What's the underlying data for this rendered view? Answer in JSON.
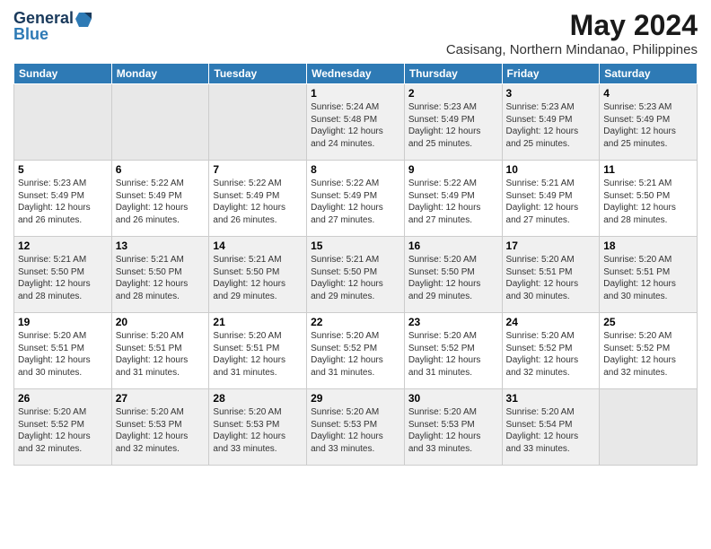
{
  "logo": {
    "line1": "General",
    "line2": "Blue"
  },
  "title": "May 2024",
  "subtitle": "Casisang, Northern Mindanao, Philippines",
  "weekdays": [
    "Sunday",
    "Monday",
    "Tuesday",
    "Wednesday",
    "Thursday",
    "Friday",
    "Saturday"
  ],
  "weeks": [
    [
      {
        "day": "",
        "info": ""
      },
      {
        "day": "",
        "info": ""
      },
      {
        "day": "",
        "info": ""
      },
      {
        "day": "1",
        "info": "Sunrise: 5:24 AM\nSunset: 5:48 PM\nDaylight: 12 hours\nand 24 minutes."
      },
      {
        "day": "2",
        "info": "Sunrise: 5:23 AM\nSunset: 5:49 PM\nDaylight: 12 hours\nand 25 minutes."
      },
      {
        "day": "3",
        "info": "Sunrise: 5:23 AM\nSunset: 5:49 PM\nDaylight: 12 hours\nand 25 minutes."
      },
      {
        "day": "4",
        "info": "Sunrise: 5:23 AM\nSunset: 5:49 PM\nDaylight: 12 hours\nand 25 minutes."
      }
    ],
    [
      {
        "day": "5",
        "info": "Sunrise: 5:23 AM\nSunset: 5:49 PM\nDaylight: 12 hours\nand 26 minutes."
      },
      {
        "day": "6",
        "info": "Sunrise: 5:22 AM\nSunset: 5:49 PM\nDaylight: 12 hours\nand 26 minutes."
      },
      {
        "day": "7",
        "info": "Sunrise: 5:22 AM\nSunset: 5:49 PM\nDaylight: 12 hours\nand 26 minutes."
      },
      {
        "day": "8",
        "info": "Sunrise: 5:22 AM\nSunset: 5:49 PM\nDaylight: 12 hours\nand 27 minutes."
      },
      {
        "day": "9",
        "info": "Sunrise: 5:22 AM\nSunset: 5:49 PM\nDaylight: 12 hours\nand 27 minutes."
      },
      {
        "day": "10",
        "info": "Sunrise: 5:21 AM\nSunset: 5:49 PM\nDaylight: 12 hours\nand 27 minutes."
      },
      {
        "day": "11",
        "info": "Sunrise: 5:21 AM\nSunset: 5:50 PM\nDaylight: 12 hours\nand 28 minutes."
      }
    ],
    [
      {
        "day": "12",
        "info": "Sunrise: 5:21 AM\nSunset: 5:50 PM\nDaylight: 12 hours\nand 28 minutes."
      },
      {
        "day": "13",
        "info": "Sunrise: 5:21 AM\nSunset: 5:50 PM\nDaylight: 12 hours\nand 28 minutes."
      },
      {
        "day": "14",
        "info": "Sunrise: 5:21 AM\nSunset: 5:50 PM\nDaylight: 12 hours\nand 29 minutes."
      },
      {
        "day": "15",
        "info": "Sunrise: 5:21 AM\nSunset: 5:50 PM\nDaylight: 12 hours\nand 29 minutes."
      },
      {
        "day": "16",
        "info": "Sunrise: 5:20 AM\nSunset: 5:50 PM\nDaylight: 12 hours\nand 29 minutes."
      },
      {
        "day": "17",
        "info": "Sunrise: 5:20 AM\nSunset: 5:51 PM\nDaylight: 12 hours\nand 30 minutes."
      },
      {
        "day": "18",
        "info": "Sunrise: 5:20 AM\nSunset: 5:51 PM\nDaylight: 12 hours\nand 30 minutes."
      }
    ],
    [
      {
        "day": "19",
        "info": "Sunrise: 5:20 AM\nSunset: 5:51 PM\nDaylight: 12 hours\nand 30 minutes."
      },
      {
        "day": "20",
        "info": "Sunrise: 5:20 AM\nSunset: 5:51 PM\nDaylight: 12 hours\nand 31 minutes."
      },
      {
        "day": "21",
        "info": "Sunrise: 5:20 AM\nSunset: 5:51 PM\nDaylight: 12 hours\nand 31 minutes."
      },
      {
        "day": "22",
        "info": "Sunrise: 5:20 AM\nSunset: 5:52 PM\nDaylight: 12 hours\nand 31 minutes."
      },
      {
        "day": "23",
        "info": "Sunrise: 5:20 AM\nSunset: 5:52 PM\nDaylight: 12 hours\nand 31 minutes."
      },
      {
        "day": "24",
        "info": "Sunrise: 5:20 AM\nSunset: 5:52 PM\nDaylight: 12 hours\nand 32 minutes."
      },
      {
        "day": "25",
        "info": "Sunrise: 5:20 AM\nSunset: 5:52 PM\nDaylight: 12 hours\nand 32 minutes."
      }
    ],
    [
      {
        "day": "26",
        "info": "Sunrise: 5:20 AM\nSunset: 5:52 PM\nDaylight: 12 hours\nand 32 minutes."
      },
      {
        "day": "27",
        "info": "Sunrise: 5:20 AM\nSunset: 5:53 PM\nDaylight: 12 hours\nand 32 minutes."
      },
      {
        "day": "28",
        "info": "Sunrise: 5:20 AM\nSunset: 5:53 PM\nDaylight: 12 hours\nand 33 minutes."
      },
      {
        "day": "29",
        "info": "Sunrise: 5:20 AM\nSunset: 5:53 PM\nDaylight: 12 hours\nand 33 minutes."
      },
      {
        "day": "30",
        "info": "Sunrise: 5:20 AM\nSunset: 5:53 PM\nDaylight: 12 hours\nand 33 minutes."
      },
      {
        "day": "31",
        "info": "Sunrise: 5:20 AM\nSunset: 5:54 PM\nDaylight: 12 hours\nand 33 minutes."
      },
      {
        "day": "",
        "info": ""
      }
    ]
  ]
}
